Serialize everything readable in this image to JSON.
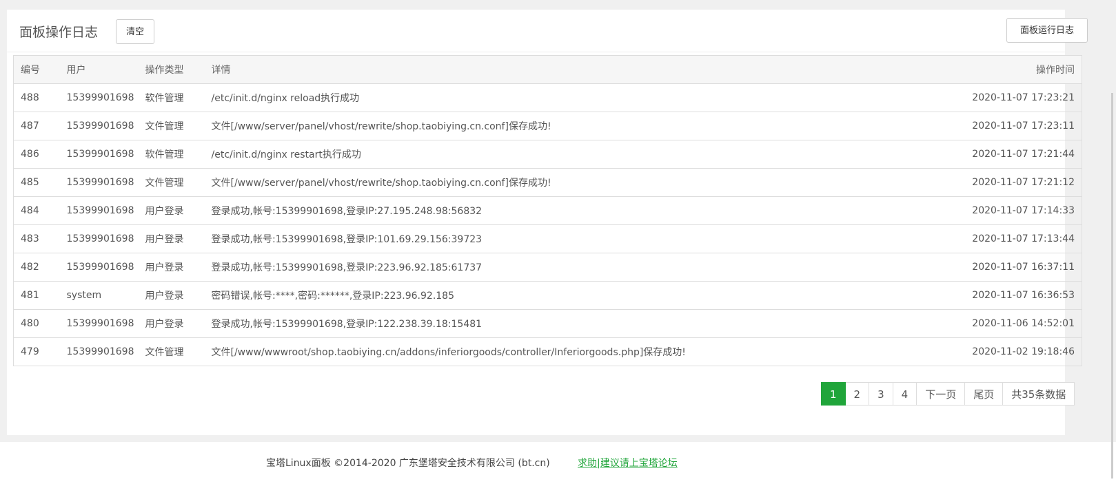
{
  "header": {
    "title": "面板操作日志",
    "clear_label": "清空",
    "runlog_label": "面板运行日志"
  },
  "table": {
    "columns": [
      "编号",
      "用户",
      "操作类型",
      "详情",
      "操作时间"
    ],
    "rows": [
      [
        "488",
        "15399901698",
        "软件管理",
        "/etc/init.d/nginx reload执行成功",
        "2020-11-07 17:23:21"
      ],
      [
        "487",
        "15399901698",
        "文件管理",
        "文件[/www/server/panel/vhost/rewrite/shop.taobiying.cn.conf]保存成功!",
        "2020-11-07 17:23:11"
      ],
      [
        "486",
        "15399901698",
        "软件管理",
        "/etc/init.d/nginx restart执行成功",
        "2020-11-07 17:21:44"
      ],
      [
        "485",
        "15399901698",
        "文件管理",
        "文件[/www/server/panel/vhost/rewrite/shop.taobiying.cn.conf]保存成功!",
        "2020-11-07 17:21:12"
      ],
      [
        "484",
        "15399901698",
        "用户登录",
        "登录成功,帐号:15399901698,登录IP:27.195.248.98:56832",
        "2020-11-07 17:14:33"
      ],
      [
        "483",
        "15399901698",
        "用户登录",
        "登录成功,帐号:15399901698,登录IP:101.69.29.156:39723",
        "2020-11-07 17:13:44"
      ],
      [
        "482",
        "15399901698",
        "用户登录",
        "登录成功,帐号:15399901698,登录IP:223.96.92.185:61737",
        "2020-11-07 16:37:11"
      ],
      [
        "481",
        "system",
        "用户登录",
        "密码错误,帐号:****,密码:******,登录IP:223.96.92.185",
        "2020-11-07 16:36:53"
      ],
      [
        "480",
        "15399901698",
        "用户登录",
        "登录成功,帐号:15399901698,登录IP:122.238.39.18:15481",
        "2020-11-06 14:52:01"
      ],
      [
        "479",
        "15399901698",
        "文件管理",
        "文件[/www/wwwroot/shop.taobiying.cn/addons/inferiorgoods/controller/Inferiorgoods.php]保存成功!",
        "2020-11-02 19:18:46"
      ]
    ]
  },
  "pager": {
    "pages": [
      "1",
      "2",
      "3",
      "4"
    ],
    "active": "1",
    "next_label": "下一页",
    "last_label": "尾页",
    "total_label": "共35条数据"
  },
  "footer": {
    "copyright": "宝塔Linux面板 ©2014-2020 广东堡塔安全技术有限公司 (bt.cn)",
    "help_link": "求助|建议请上宝塔论坛"
  },
  "colors": {
    "accent": "#20a53a"
  }
}
